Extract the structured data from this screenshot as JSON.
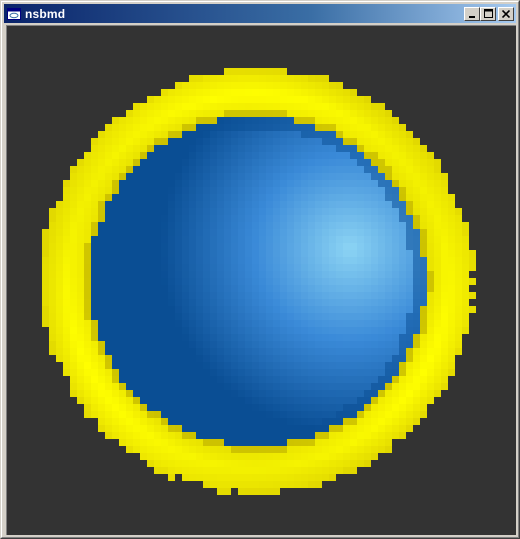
{
  "window": {
    "title": "nsbmd",
    "icon": "app-window-icon",
    "buttons": {
      "minimize": "minimize-icon",
      "maximize": "maximize-icon",
      "close": "close-icon"
    }
  },
  "viewport": {
    "background_color": "#333333",
    "model": {
      "ring_colors": {
        "light": "#ffff00",
        "mid": "#e6dd00",
        "dark": "#b8aa00"
      },
      "sphere_colors": {
        "highlight": "#8cd4f4",
        "mid": "#3a8ad8",
        "dark": "#0a4e94"
      }
    }
  }
}
